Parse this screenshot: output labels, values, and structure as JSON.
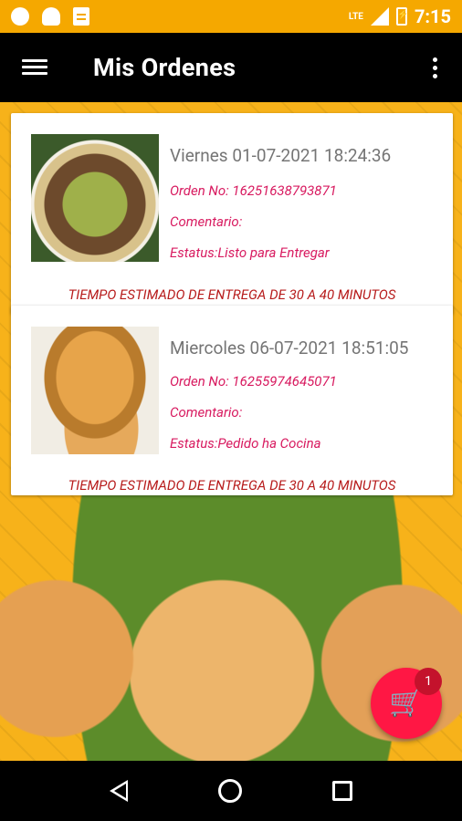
{
  "status_bar": {
    "time": "7:15",
    "network": "LTE"
  },
  "app_bar": {
    "title": "Mis Ordenes"
  },
  "orders": [
    {
      "date": "Viernes 01-07-2021 18:24:36",
      "order_no": "Orden No: 16251638793871",
      "comment": "Comentario:",
      "status": "Estatus:Listo para Entregar",
      "eta": "TIEMPO ESTIMADO DE ENTREGA DE 30 A 40 MINUTOS"
    },
    {
      "date": "Miercoles 06-07-2021 18:51:05",
      "order_no": "Orden No: 16255974645071",
      "comment": "Comentario:",
      "status": "Estatus:Pedido ha Cocina",
      "eta": "TIEMPO ESTIMADO DE ENTREGA DE 30 A 40 MINUTOS"
    }
  ],
  "cart": {
    "count": "1",
    "icon": "shopping-cart-icon"
  },
  "colors": {
    "status_bar": "#f5a800",
    "app_bar": "#000000",
    "accent_text": "#d81b60",
    "eta_text": "#b71c1c",
    "fab": "#ff1744"
  }
}
